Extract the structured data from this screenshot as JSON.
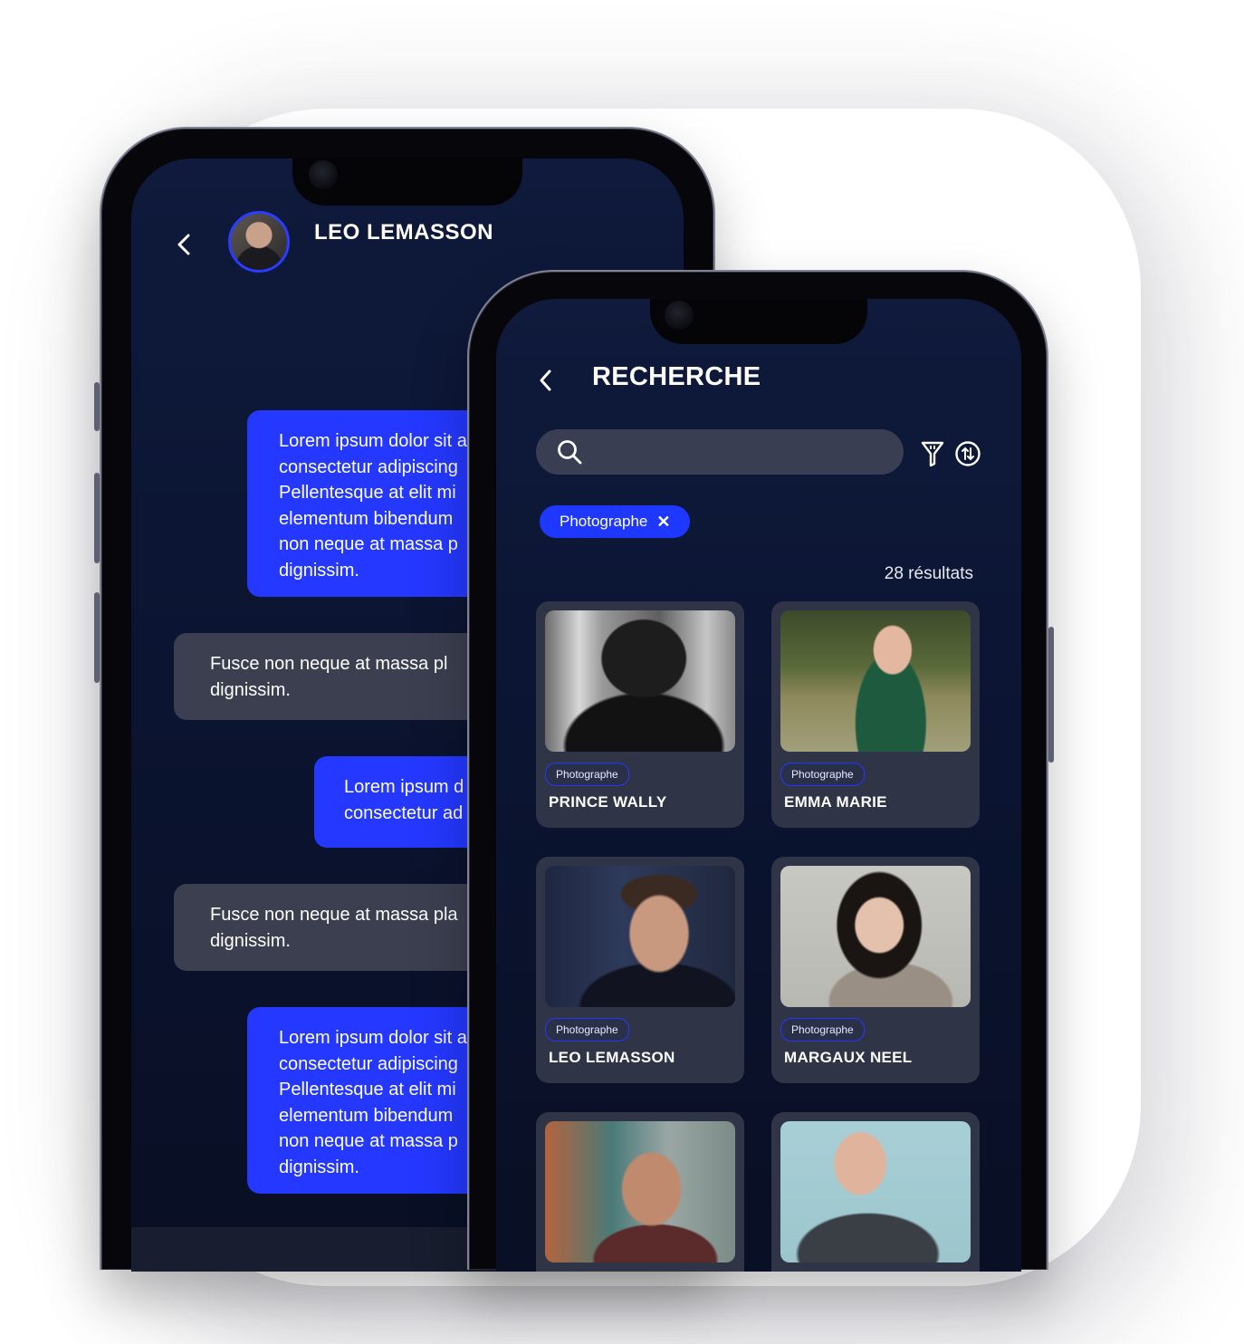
{
  "chat": {
    "contact_name": "LEO LEMASSON",
    "messages": [
      {
        "direction": "out",
        "text": "Lorem ipsum dolor sit a\nconsectetur adipiscing\nPellentesque at elit mi\nelementum bibendum\nnon neque at massa p\ndignissim."
      },
      {
        "direction": "in",
        "text": "Fusce non neque at massa pl\ndignissim."
      },
      {
        "direction": "out",
        "text": "Lorem ipsum d\nconsectetur ad"
      },
      {
        "direction": "in",
        "text": "Fusce non neque at massa pla\ndignissim."
      },
      {
        "direction": "out",
        "text": "Lorem ipsum dolor sit a\nconsectetur adipiscing\nPellentesque at elit mi\nelementum bibendum\nnon neque at massa p\ndignissim."
      }
    ]
  },
  "search": {
    "title": "RECHERCHE",
    "query": "",
    "active_filter": "Photographe",
    "results_label": "28 résultats",
    "cards": [
      {
        "tag": "Photographe",
        "name": "PRINCE WALLY"
      },
      {
        "tag": "Photographe",
        "name": "EMMA MARIE"
      },
      {
        "tag": "Photographe",
        "name": "LEO LEMASSON"
      },
      {
        "tag": "Photographe",
        "name": "MARGAUX NEEL"
      },
      {
        "tag": "",
        "name": ""
      },
      {
        "tag": "",
        "name": ""
      }
    ]
  },
  "colors": {
    "accent": "#2438FF",
    "background_top": "#0F1A3C",
    "incoming_bubble": "#3B3F50",
    "card": "#2F3447"
  },
  "icons": [
    "back-arrow-icon",
    "search-icon",
    "filter-icon",
    "sort-icon",
    "close-icon"
  ]
}
